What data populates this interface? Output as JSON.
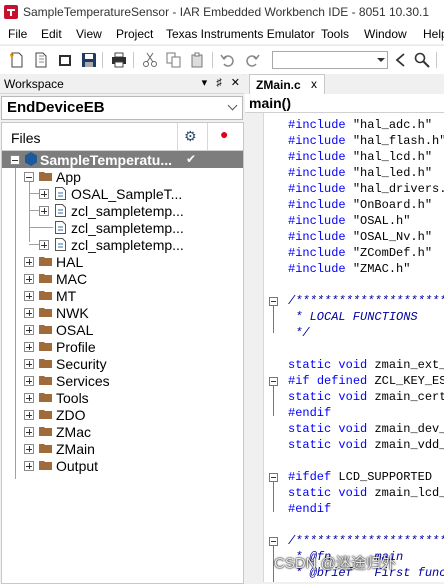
{
  "window": {
    "title": "SampleTemperatureSensor - IAR Embedded Workbench IDE - 8051 10.30.1"
  },
  "menu": [
    "File",
    "Edit",
    "View",
    "Project",
    "Texas Instruments Emulator",
    "Tools",
    "Window",
    "Help"
  ],
  "workspace": {
    "title": "Workspace",
    "header_buttons": [
      "▾",
      "♯",
      "✕"
    ],
    "configuration": "EndDeviceEB",
    "files_label": "Files",
    "tree": [
      {
        "label": "SampleTemperatu...",
        "type": "project",
        "selected": true
      },
      {
        "label": "App",
        "type": "folder",
        "expanded": true
      },
      {
        "label": "OSAL_SampleT...",
        "type": "file",
        "expandable": true
      },
      {
        "label": "zcl_sampletemp...",
        "type": "file",
        "expandable": true
      },
      {
        "label": "zcl_sampletemp...",
        "type": "file",
        "expandable": false
      },
      {
        "label": "zcl_sampletemp...",
        "type": "file",
        "expandable": true
      },
      {
        "label": "HAL",
        "type": "folder"
      },
      {
        "label": "MAC",
        "type": "folder"
      },
      {
        "label": "MT",
        "type": "folder"
      },
      {
        "label": "NWK",
        "type": "folder"
      },
      {
        "label": "OSAL",
        "type": "folder"
      },
      {
        "label": "Profile",
        "type": "folder"
      },
      {
        "label": "Security",
        "type": "folder"
      },
      {
        "label": "Services",
        "type": "folder"
      },
      {
        "label": "Tools",
        "type": "folder"
      },
      {
        "label": "ZDO",
        "type": "folder"
      },
      {
        "label": "ZMac",
        "type": "folder"
      },
      {
        "label": "ZMain",
        "type": "folder"
      },
      {
        "label": "Output",
        "type": "folder"
      }
    ]
  },
  "editor": {
    "tab": "ZMain.c",
    "tab_close": "x",
    "function": "main()",
    "code": [
      "#include \"hal_adc.h\"",
      "#include \"hal_flash.h\"",
      "#include \"hal_lcd.h\"",
      "#include \"hal_led.h\"",
      "#include \"hal_drivers.h\"",
      "#include \"OnBoard.h\"",
      "#include \"OSAL.h\"",
      "#include \"OSAL_Nv.h\"",
      "#include \"ZComDef.h\"",
      "#include \"ZMAC.h\"",
      "",
      "/*****************************************",
      " * LOCAL FUNCTIONS",
      " */",
      "",
      "static void zmain_ext_addr(",
      "#if defined ZCL_KEY_ESTABLISH",
      "static void zmain_cert_init(",
      "#endif",
      "static void zmain_dev_info(",
      "static void zmain_vdd_check(",
      "",
      "#ifdef LCD_SUPPORTED",
      "static void zmain_lcd_init(",
      "#endif",
      "",
      "/*****************************************",
      " * @fn      main",
      " * @brief   First function"
    ]
  },
  "watermark": "CSDN @迷途归外"
}
